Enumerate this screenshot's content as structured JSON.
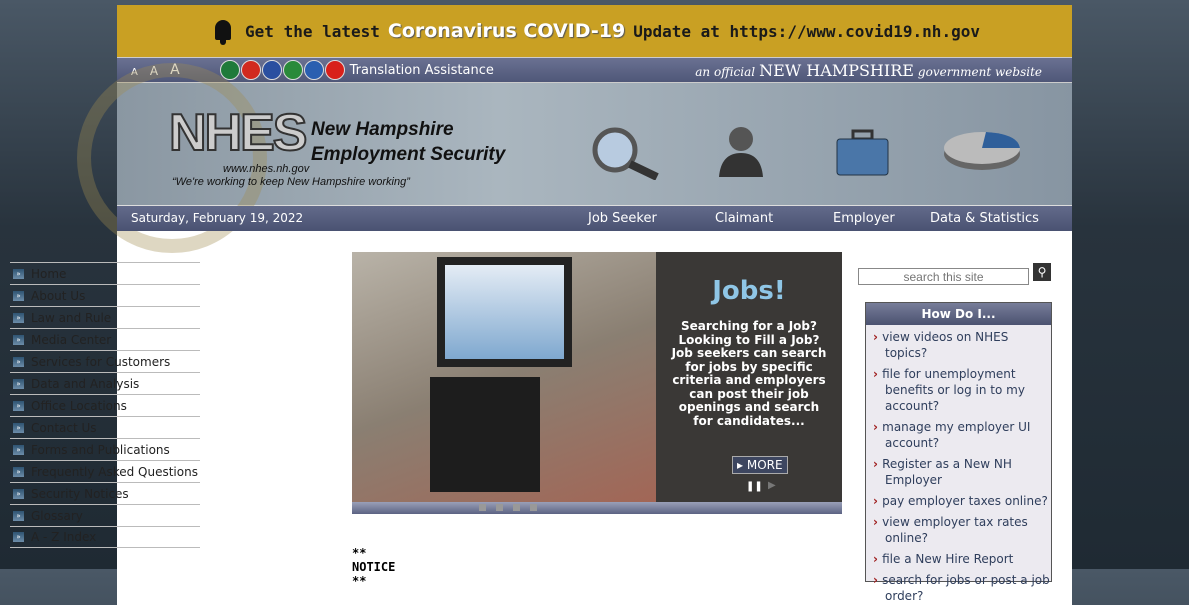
{
  "banner": {
    "prefix": "Get the latest",
    "highlight": "Coronavirus COVID-19",
    "suffix": "Update at https://www.covid19.nh.gov",
    "icon": "bell-icon"
  },
  "topbar": {
    "font_sizes": [
      "A",
      "A",
      "A"
    ],
    "flags": [
      {
        "name": "mexico",
        "color": "#1f7a3a"
      },
      {
        "name": "germany",
        "color": "#d12a1f"
      },
      {
        "name": "france",
        "color": "#2a4fa0"
      },
      {
        "name": "italy",
        "color": "#2a8a3a"
      },
      {
        "name": "greece",
        "color": "#2a5fb0"
      },
      {
        "name": "china",
        "color": "#d8201a"
      }
    ],
    "translation": "Translation  Assistance",
    "official_prefix": "an official",
    "official_state": "NEW HAMPSHIRE",
    "official_suffix": "government website"
  },
  "header": {
    "logo": "NHES",
    "org_line1": "New Hampshire",
    "org_line2": "Employment Security",
    "url": "www.nhes.nh.gov",
    "tagline": "“We're working to keep New Hampshire working”"
  },
  "navbar": {
    "date": "Saturday, February 19, 2022",
    "items": [
      "Job Seeker",
      "Claimant",
      "Employer",
      "Data & Statistics"
    ]
  },
  "sidebar": {
    "items": [
      "Home",
      "About Us",
      "Law and Rule",
      "Media Center",
      "Services for Customers",
      "Data and Analysis",
      "Office Locations",
      "Contact Us",
      "Forms and Publications",
      "Frequently Asked Questions",
      "Security Notices",
      "Glossary",
      "A - Z Index"
    ]
  },
  "slideshow": {
    "title": "Jobs!",
    "text": "Searching for a Job? Looking to Fill a Job? Job seekers can search for jobs by specific criteria and employers can post their job openings and search for candidates...",
    "more": "MORE"
  },
  "notice": "** NOTICE **",
  "search": {
    "placeholder": "search this site"
  },
  "how_do_i": {
    "title": "How Do I...",
    "items": [
      "view videos on NHES topics?",
      "file for unemployment benefits or log in to my account?",
      "manage my employer UI account?",
      "Register as a New NH Employer",
      "pay employer taxes online?",
      "view employer tax rates online?",
      "file a New Hire Report",
      "search for jobs or post a job order?"
    ]
  }
}
